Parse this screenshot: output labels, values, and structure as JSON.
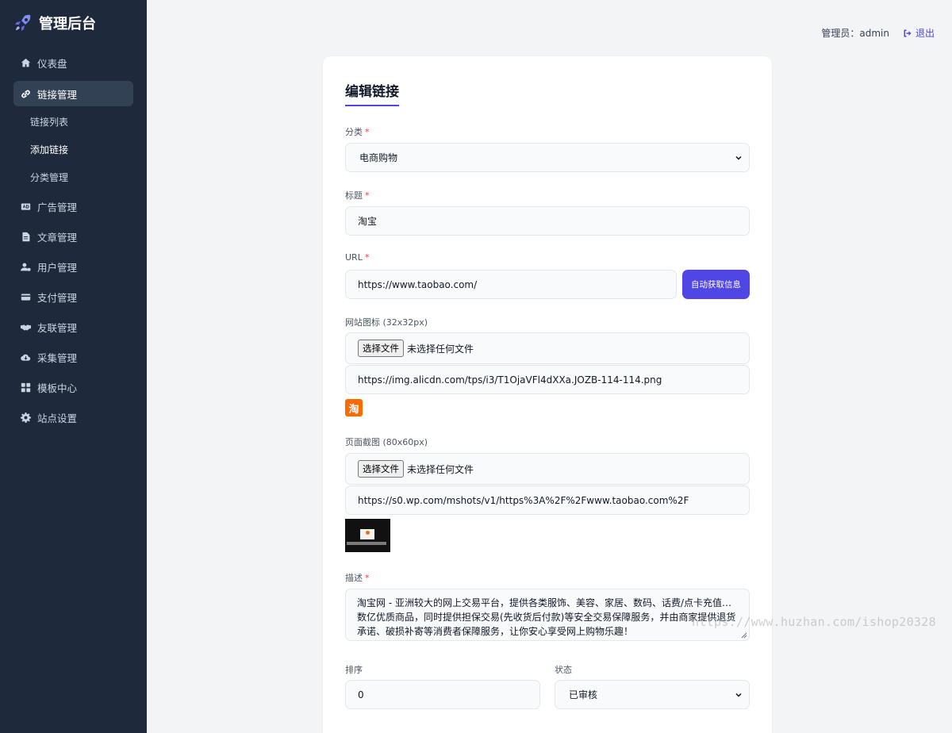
{
  "brand": {
    "title": "管理后台",
    "icon": "rocket-icon"
  },
  "sidebar": {
    "items": [
      {
        "label": "仪表盘",
        "icon": "home-icon"
      },
      {
        "label": "链接管理",
        "icon": "link-icon"
      },
      {
        "label": "广告管理",
        "icon": "ad-icon"
      },
      {
        "label": "文章管理",
        "icon": "file-icon"
      },
      {
        "label": "用户管理",
        "icon": "user-gear-icon"
      },
      {
        "label": "支付管理",
        "icon": "credit-card-icon"
      },
      {
        "label": "友联管理",
        "icon": "handshake-icon"
      },
      {
        "label": "采集管理",
        "icon": "cloud-download-icon"
      },
      {
        "label": "模板中心",
        "icon": "grid-icon"
      },
      {
        "label": "站点设置",
        "icon": "gear-icon"
      }
    ],
    "subitems": [
      {
        "label": "链接列表"
      },
      {
        "label": "添加链接"
      },
      {
        "label": "分类管理"
      }
    ]
  },
  "topbar": {
    "admin_label": "管理员：admin",
    "logout_label": "退出"
  },
  "form": {
    "title": "编辑链接",
    "category": {
      "label": "分类",
      "value": "电商购物"
    },
    "title_field": {
      "label": "标题",
      "value": "淘宝"
    },
    "url": {
      "label": "URL",
      "value": "https://www.taobao.com/",
      "button": "自动获取信息"
    },
    "icon": {
      "label": "网站图标 (32x32px)",
      "file_button": "选择文件",
      "file_status": "未选择任何文件",
      "value": "https://img.alicdn.com/tps/i3/T1OjaVFl4dXXa.JOZB-114-114.png",
      "preview_glyph": "淘"
    },
    "screenshot": {
      "label": "页面截图 (80x60px)",
      "file_button": "选择文件",
      "file_status": "未选择任何文件",
      "value": "https://s0.wp.com/mshots/v1/https%3A%2F%2Fwww.taobao.com%2F"
    },
    "description": {
      "label": "描述",
      "value": "淘宝网 - 亚洲较大的网上交易平台，提供各类服饰、美容、家居、数码、话费/点卡充值… 数亿优质商品，同时提供担保交易(先收货后付款)等安全交易保障服务，并由商家提供退货承诺、破损补寄等消费者保障服务，让你安心享受网上购物乐趣！"
    },
    "sort": {
      "label": "排序",
      "value": "0"
    },
    "status": {
      "label": "状态",
      "value": "已审核"
    },
    "required_mark": "*"
  },
  "watermark": "https://www.huzhan.com/ishop20328",
  "colors": {
    "sidebar_bg": "#1e293b",
    "accent": "#4f46e5",
    "required": "#ef4444"
  }
}
